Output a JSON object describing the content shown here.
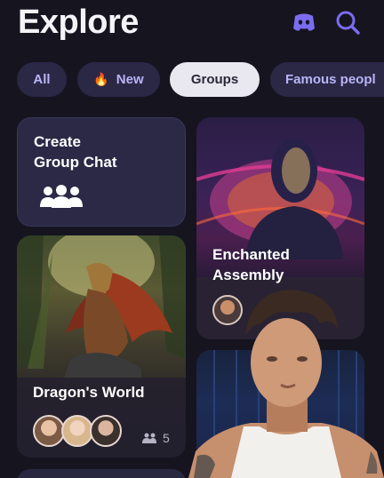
{
  "header": {
    "title": "Explore",
    "icons": [
      "discord-icon",
      "search-icon"
    ]
  },
  "chips": [
    {
      "label": "All"
    },
    {
      "label": "New",
      "icon": "fire-icon"
    },
    {
      "label": "Groups",
      "selected": true
    },
    {
      "label": "Famous peopl"
    }
  ],
  "cards": {
    "create": {
      "line1": "Create",
      "line2": "Group Chat",
      "icon": "people-icon"
    },
    "enchanted": {
      "line1": "Enchanted",
      "line2": "Assembly"
    },
    "dragon": {
      "name": "Dragon's World",
      "member_count": "5"
    }
  },
  "colors": {
    "background": "#16141f",
    "chip": "#2b2846",
    "chip_text": "#b9b4f5",
    "chip_selected": "#e9e8f0",
    "card": "#2b2945",
    "accent": "#7b6cf0"
  }
}
